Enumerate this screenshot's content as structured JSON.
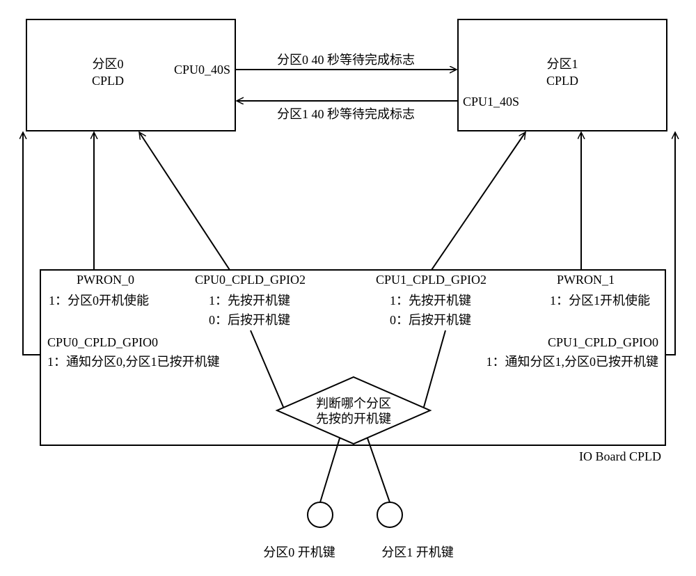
{
  "partition0": {
    "line1": "分区0",
    "line2": "CPLD"
  },
  "partition1": {
    "line1": "分区1",
    "line2": "CPLD"
  },
  "signals": {
    "cpu0_40s": "CPU0_40S",
    "cpu0_40s_desc": "分区0 40 秒等待完成标志",
    "cpu1_40s": "CPU1_40S",
    "cpu1_40s_desc": "分区1 40 秒等待完成标志",
    "pwron0": "PWRON_0",
    "pwron0_desc": "1：分区0开机使能",
    "cpu0_gpio2": "CPU0_CPLD_GPIO2",
    "cpu0_gpio2_d1": "1：先按开机键",
    "cpu0_gpio2_d0": "0：后按开机键",
    "cpu1_gpio2": "CPU1_CPLD_GPIO2",
    "cpu1_gpio2_d1": "1：先按开机键",
    "cpu1_gpio2_d0": "0：后按开机键",
    "pwron1": "PWRON_1",
    "pwron1_desc": "1：分区1开机使能",
    "cpu0_gpio0": "CPU0_CPLD_GPIO0",
    "cpu0_gpio0_desc": "1：通知分区0,分区1已按开机键",
    "cpu1_gpio0": "CPU1_CPLD_GPIO0",
    "cpu1_gpio0_desc": "1：通知分区1,分区0已按开机键"
  },
  "decision": {
    "line1": "判断哪个分区",
    "line2": "先按的开机键"
  },
  "io_board": "IO Board CPLD",
  "buttons": {
    "btn0": "分区0 开机键",
    "btn1": "分区1 开机键"
  }
}
